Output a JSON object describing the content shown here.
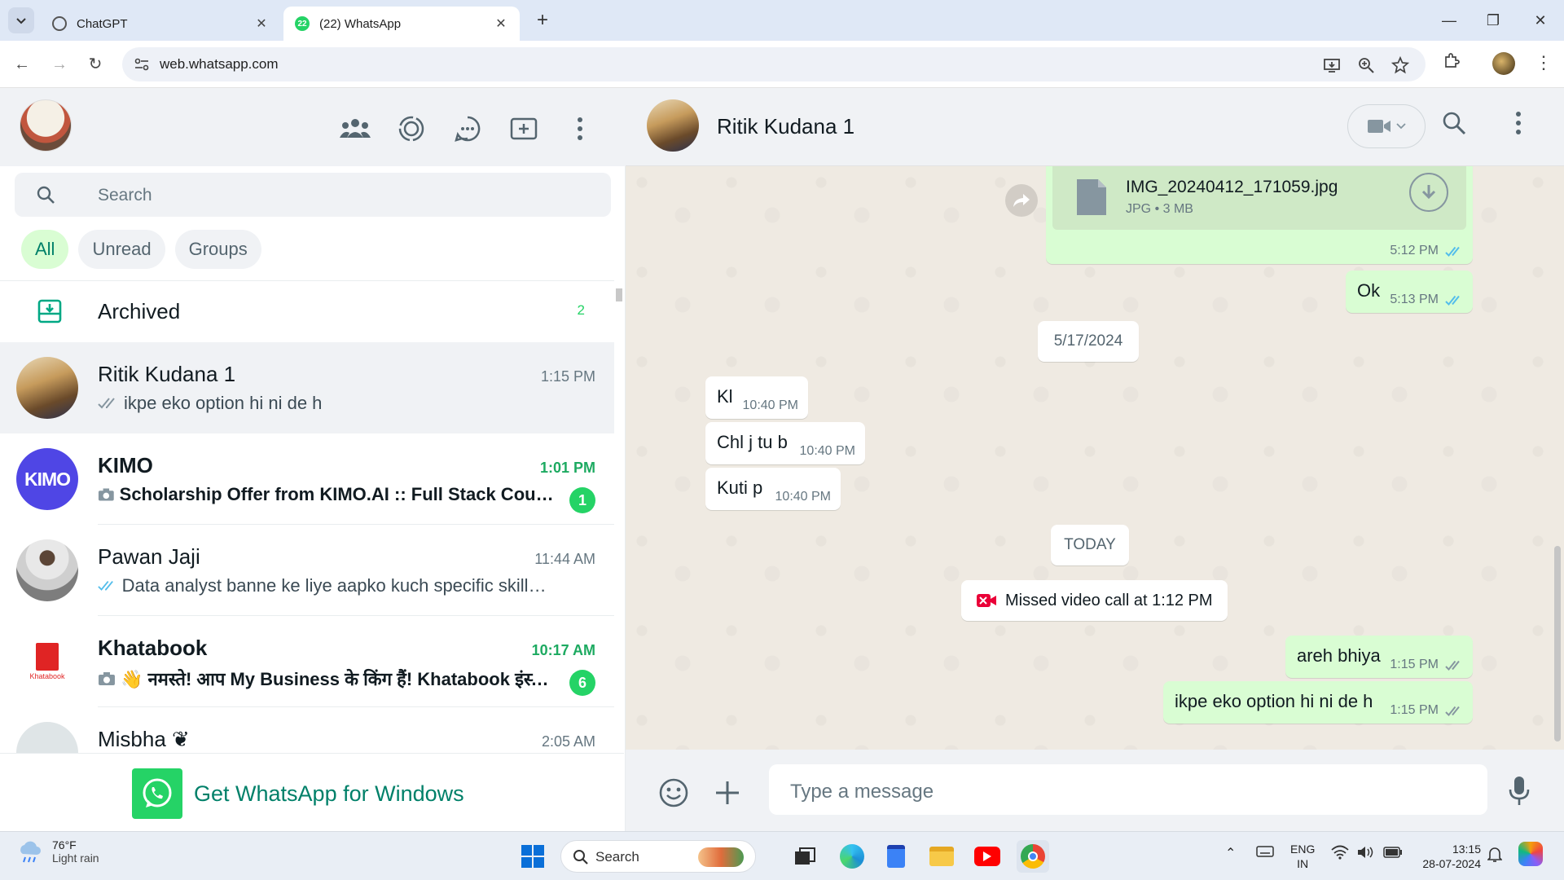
{
  "browser": {
    "tabs": [
      {
        "title": "ChatGPT",
        "active": false
      },
      {
        "title": "(22) WhatsApp",
        "active": true
      }
    ],
    "url": "web.whatsapp.com"
  },
  "left": {
    "search_placeholder": "Search",
    "filters": [
      "All",
      "Unread",
      "Groups"
    ],
    "archived": {
      "label": "Archived",
      "count": "2"
    },
    "chats": [
      {
        "name": "Ritik Kudana 1",
        "time": "1:15 PM",
        "preview": "ikpe eko option hi ni de h",
        "unread": "",
        "selected": true
      },
      {
        "name": "KIMO",
        "time": "1:01 PM",
        "preview": "Scholarship Offer from KIMO.AI :: Full Stack Course ...",
        "unread": "1",
        "selected": false
      },
      {
        "name": "Pawan Jaji",
        "time": "11:44 AM",
        "preview": "Data analyst banne ke liye aapko kuch specific skills aur k...",
        "unread": "",
        "selected": false
      },
      {
        "name": "Khatabook",
        "time": "10:17 AM",
        "preview": "👋 नमस्ते! आप My Business के किंग हैं! Khatabook इंस्टें...",
        "unread": "6",
        "selected": false
      },
      {
        "name": "Misbha ❦",
        "time": "2:05 AM",
        "preview": "",
        "unread": "",
        "selected": false
      }
    ],
    "avatar_texts": {
      "kimo": "KIMO",
      "khatabook": "Khatabook"
    },
    "get_app": "Get WhatsApp for Windows"
  },
  "conversation": {
    "contact": "Ritik Kudana 1",
    "file": {
      "name": "IMG_20240412_171059.jpg",
      "meta": "JPG • 3 MB",
      "time": "5:12 PM"
    },
    "messages": [
      {
        "text": "Ok",
        "time": "5:13 PM",
        "dir": "out"
      },
      {
        "text": "Kl",
        "time": "10:40 PM",
        "dir": "in"
      },
      {
        "text": "Chl j tu b",
        "time": "10:40 PM",
        "dir": "in"
      },
      {
        "text": "Kuti p",
        "time": "10:40 PM",
        "dir": "in"
      },
      {
        "text": "areh bhiya",
        "time": "1:15 PM",
        "dir": "out"
      },
      {
        "text": "ikpe eko option hi ni de h",
        "time": "1:15 PM",
        "dir": "out"
      }
    ],
    "date_old": "5/17/2024",
    "date_today": "TODAY",
    "missed_call": "Missed video call at 1:12 PM",
    "composer_placeholder": "Type a message"
  },
  "taskbar": {
    "weather_temp": "76°F",
    "weather_desc": "Light rain",
    "search": "Search",
    "lang1": "ENG",
    "lang2": "IN",
    "time": "13:15",
    "date": "28-07-2024"
  },
  "colors": {
    "accent": "#25d366",
    "wa_green_text": "#008069",
    "out_bubble": "#d9fdd3",
    "tick_blue": "#53bdeb"
  }
}
